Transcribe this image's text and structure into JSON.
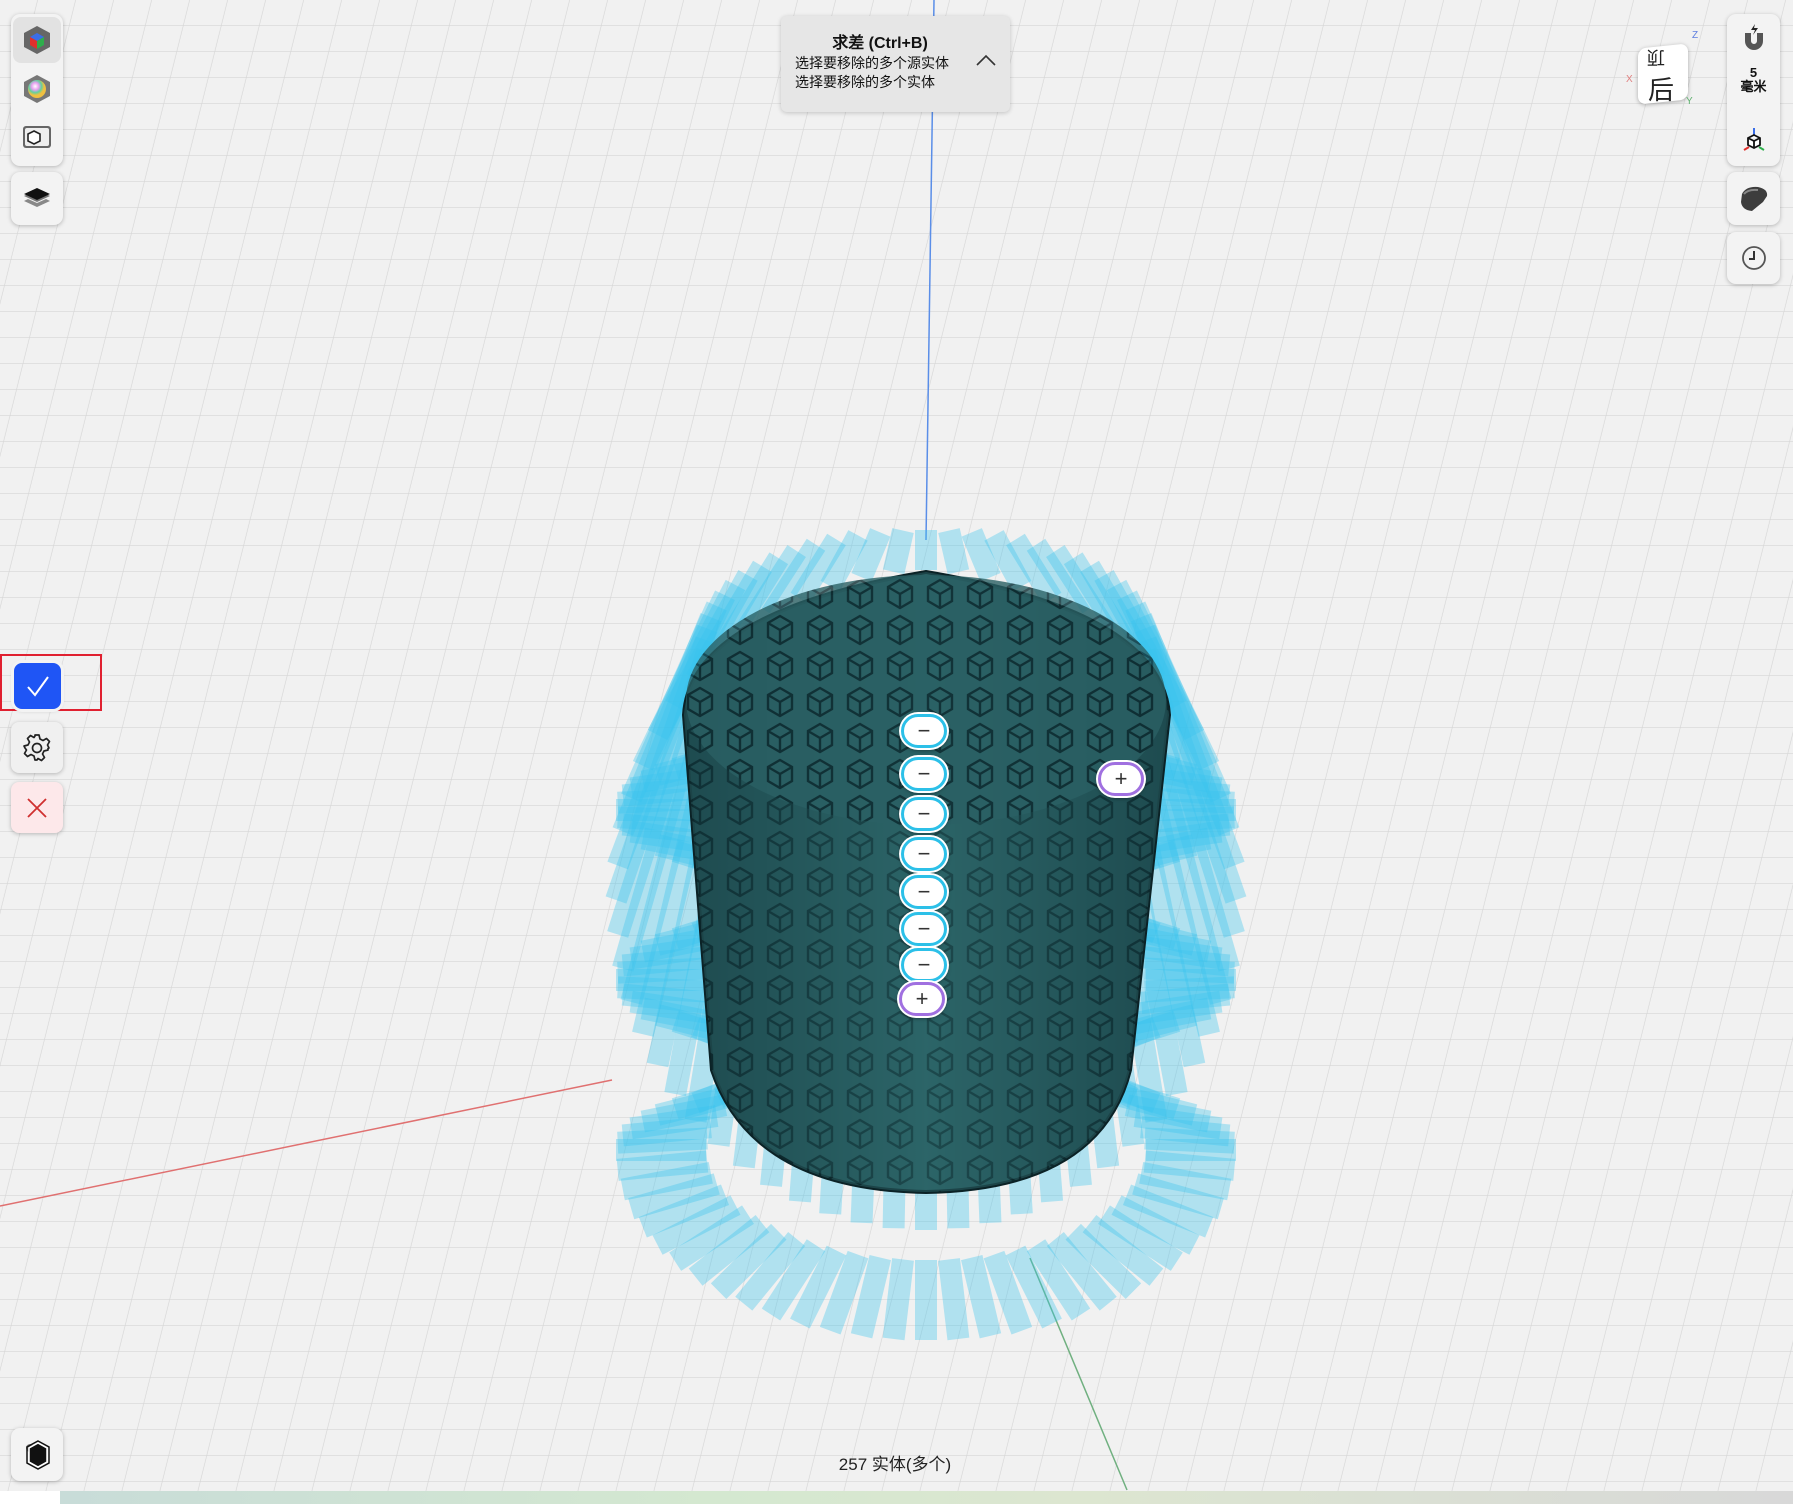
{
  "left_toolbar": {
    "items": [
      {
        "name": "view-cube-icon",
        "label": ""
      },
      {
        "name": "color-sphere-icon",
        "label": ""
      },
      {
        "name": "render-mode-icon",
        "label": ""
      },
      {
        "name": "layers-icon",
        "label": ""
      }
    ]
  },
  "tooltip": {
    "title": "求差 (Ctrl+B)",
    "line1": "选择要移除的多个源实体",
    "line2": "选择要移除的多个实体"
  },
  "right_toolbar": {
    "snap_value": "5",
    "snap_unit": "毫米"
  },
  "nav_cube": {
    "top": "顶",
    "back": "后",
    "x": "X",
    "y": "Y",
    "z": "Z"
  },
  "actions": {
    "confirm": "✓",
    "settings": "settings",
    "cancel": "✕"
  },
  "markers": {
    "minus": [
      "−",
      "−",
      "−",
      "−",
      "−",
      "−",
      "−"
    ],
    "plus": [
      "+",
      "+"
    ]
  },
  "status": {
    "text": "257 实体(多个)"
  },
  "colors": {
    "accent": "#1f55f5",
    "highlight": "#e02030",
    "solid": "#1e4c50",
    "tool": "#39c4ee"
  }
}
